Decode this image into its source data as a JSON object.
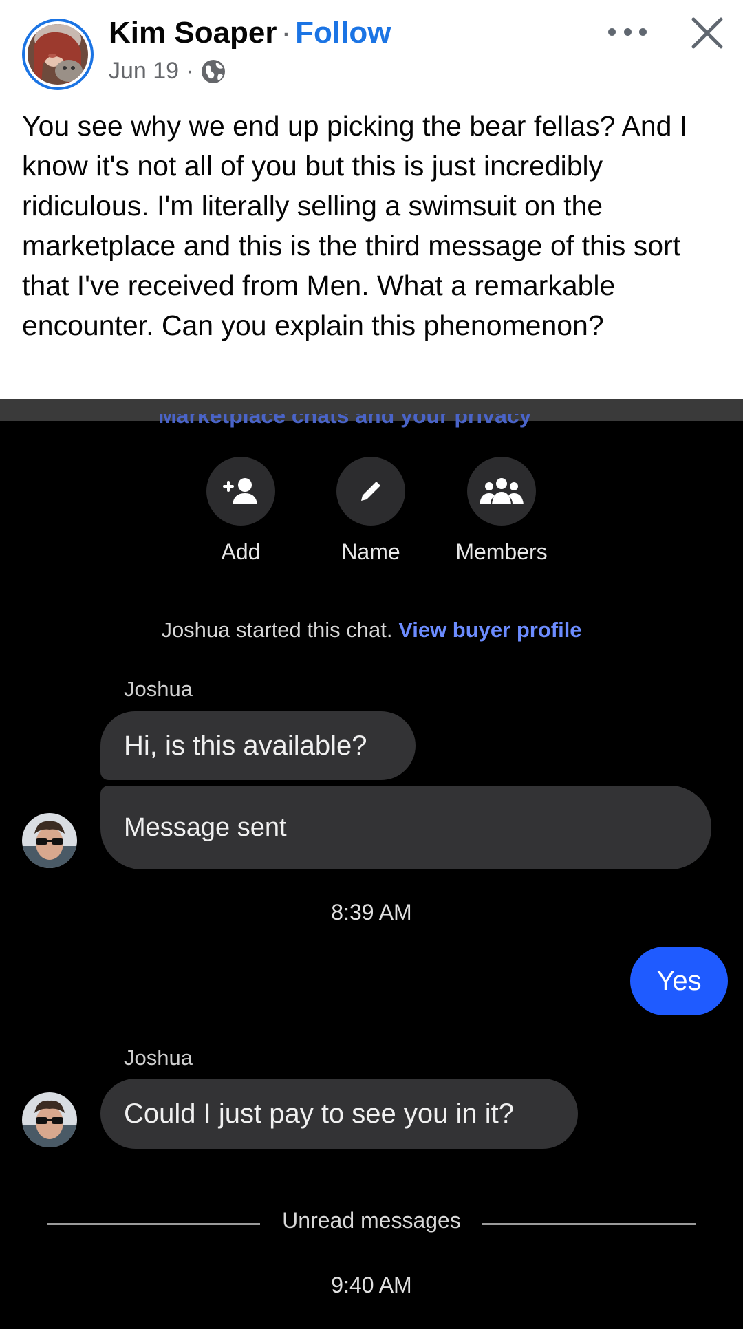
{
  "post": {
    "author": "Kim Soaper",
    "separator": "·",
    "follow_label": "Follow",
    "date": "Jun 19",
    "date_separator": "·",
    "privacy_icon": "globe-icon",
    "text": "You see why we end up picking the bear fellas? And I know it's not all of you but this is just incredibly ridiculous. I'm literally selling a swimsuit on the marketplace and this is the third message of this sort that I've received from Men. What a remarkable encounter. Can you explain this phenomenon?"
  },
  "screenshot": {
    "cutoff_heading": "Marketplace chats and your privacy",
    "actions": [
      {
        "label": "Add",
        "icon": "add-person-icon"
      },
      {
        "label": "Name",
        "icon": "pencil-icon"
      },
      {
        "label": "Members",
        "icon": "members-icon"
      }
    ],
    "started_text": "Joshua started this chat.",
    "started_link": "View buyer profile",
    "messages": [
      {
        "sender": "Joshua",
        "text": "Hi, is this available?"
      },
      {
        "text": "Message sent"
      },
      {
        "time": "8:39 AM"
      },
      {
        "outgoing": "Yes"
      },
      {
        "sender": "Joshua",
        "text": "Could I just pay to see you in it?"
      }
    ],
    "unread_label": "Unread messages",
    "last_time": "9:40 AM"
  },
  "colors": {
    "facebook_blue": "#1b74e4",
    "outgoing_bubble": "#1f5bff",
    "incoming_bubble": "#333335",
    "link_purple": "#6c8cff"
  }
}
